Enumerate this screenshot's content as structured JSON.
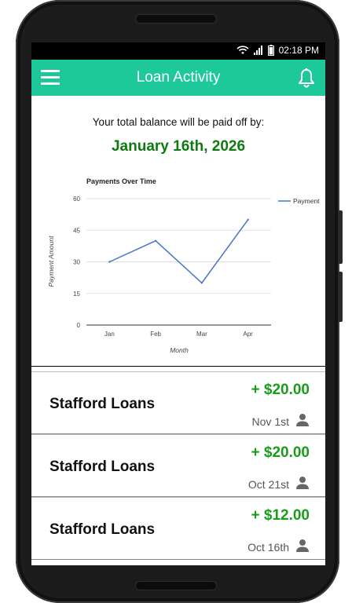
{
  "status_bar": {
    "time": "02:18 PM"
  },
  "app_bar": {
    "title": "Loan Activity"
  },
  "summary": {
    "payoff_text": "Your total balance will be paid off by:",
    "payoff_date": "January 16th, 2026"
  },
  "colors": {
    "accent": "#1dc99b",
    "amount": "#1a9c1a",
    "date": "#0f7a0f",
    "series": "#4a72c8"
  },
  "chart_data": {
    "type": "line",
    "title": "Payments Over Time",
    "xlabel": "Month",
    "ylabel": "Payment Amount",
    "categories": [
      "Jan",
      "Feb",
      "Mar",
      "Apr"
    ],
    "series": [
      {
        "name": "Payment",
        "values": [
          30,
          40,
          20,
          50
        ]
      }
    ],
    "ylim": [
      0,
      60
    ],
    "yticks": [
      0,
      15,
      30,
      45,
      60
    ],
    "grid": true,
    "legend": "right"
  },
  "activities": [
    {
      "title": "Stafford Loans",
      "amount": "+ $20.00",
      "date": "Nov 1st"
    },
    {
      "title": "Stafford Loans",
      "amount": "+ $20.00",
      "date": "Oct 21st"
    },
    {
      "title": "Stafford Loans",
      "amount": "+ $12.00",
      "date": "Oct 16th"
    }
  ]
}
